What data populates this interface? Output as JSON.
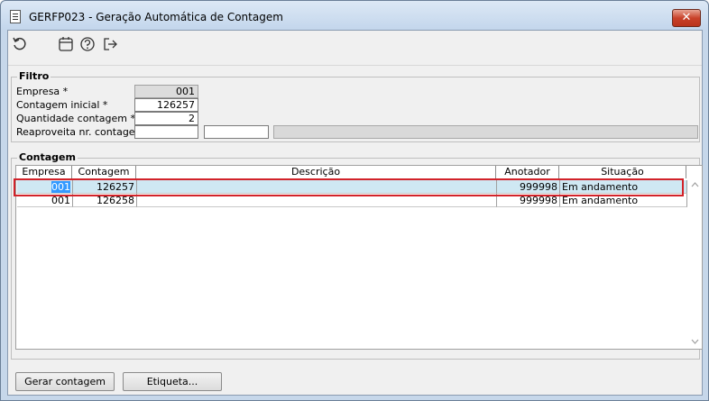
{
  "window": {
    "title": "GERFP023 - Geração Automática de Contagem",
    "close_glyph": "✕"
  },
  "toolbar": {
    "icons": [
      "refresh-icon",
      "calendar-icon",
      "help-icon",
      "exit-icon"
    ]
  },
  "filtro": {
    "title": "Filtro",
    "empresa_label": "Empresa *",
    "empresa_value": "001",
    "contagem_inicial_label": "Contagem inicial *",
    "contagem_inicial_value": "126257",
    "quantidade_label": "Quantidade contagem *",
    "quantidade_value": "2",
    "reaproveita_label": "Reaproveita nr. contagem",
    "reaproveita_value": "",
    "reaproveita_value2": ""
  },
  "contagem": {
    "title": "Contagem",
    "columns": [
      "Empresa",
      "Contagem",
      "Descrição",
      "Anotador",
      "Situação"
    ],
    "rows": [
      {
        "empresa": "001",
        "contagem": "126257",
        "descricao": "",
        "anotador": "999998",
        "situacao": "Em andamento"
      },
      {
        "empresa": "001",
        "contagem": "126258",
        "descricao": "",
        "anotador": "999998",
        "situacao": "Em andamento"
      }
    ]
  },
  "buttons": {
    "gerar_label": "Gerar contagem",
    "etiqueta_label": "Etiqueta..."
  },
  "colors": {
    "selection_outline": "#d2232a",
    "selection_fill": "#cfe8f3"
  }
}
